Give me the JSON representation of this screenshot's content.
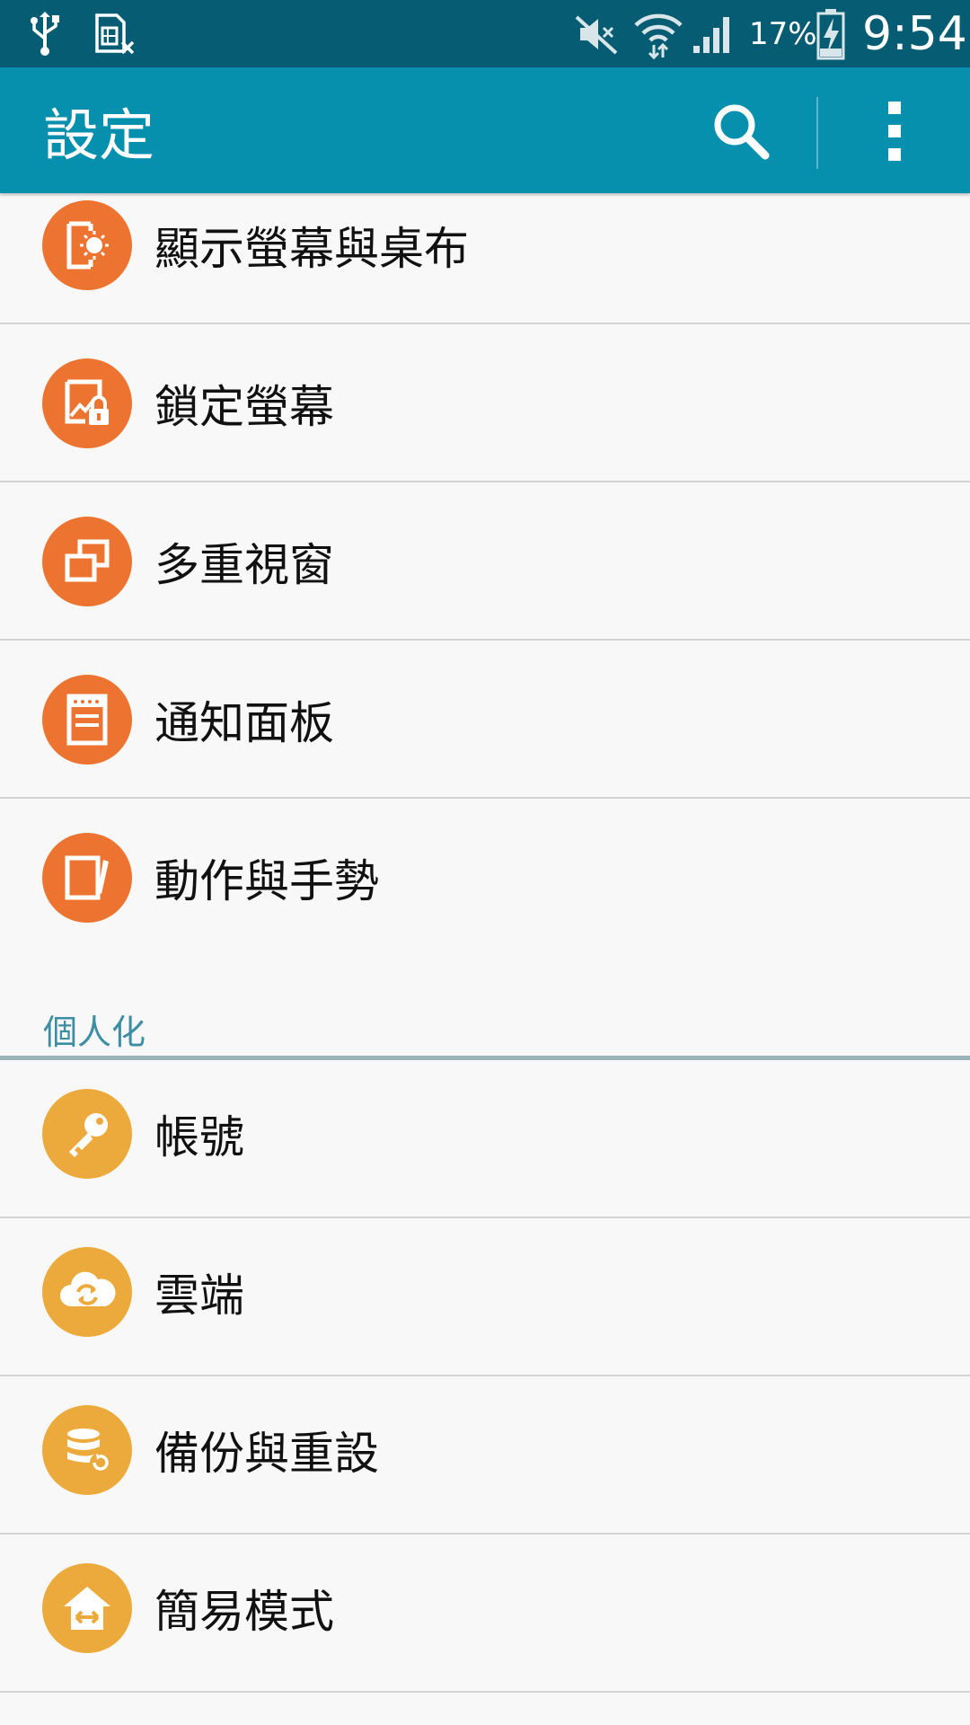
{
  "status_bar": {
    "battery_percent": "17%",
    "time": "9:54",
    "icons": [
      "usb-icon",
      "sim-card-off-icon",
      "mute-icon",
      "wifi-icon",
      "cell-signal-icon",
      "battery-charging-icon"
    ]
  },
  "app_bar": {
    "title": "設定",
    "icons": [
      "search-icon",
      "more-vert-icon"
    ]
  },
  "list": {
    "rows_top": [
      {
        "label": "顯示螢幕與桌布",
        "icon": "display-wallpaper-icon"
      },
      {
        "label": "鎖定螢幕",
        "icon": "lock-screen-icon"
      },
      {
        "label": "多重視窗",
        "icon": "multi-window-icon"
      },
      {
        "label": "通知面板",
        "icon": "notification-panel-icon"
      },
      {
        "label": "動作與手勢",
        "icon": "motions-gestures-icon"
      }
    ],
    "section_header": "個人化",
    "rows_bottom": [
      {
        "label": "帳號",
        "icon": "key-icon"
      },
      {
        "label": "雲端",
        "icon": "cloud-sync-icon"
      },
      {
        "label": "備份與重設",
        "icon": "backup-reset-icon"
      },
      {
        "label": "簡易模式",
        "icon": "easy-mode-icon"
      }
    ]
  },
  "colors": {
    "status_bar": "#055c73",
    "app_bar": "#078fae",
    "orange_icon": "#ec7430",
    "amber_icon": "#ebaa3b",
    "section_header": "#3d8da3"
  }
}
